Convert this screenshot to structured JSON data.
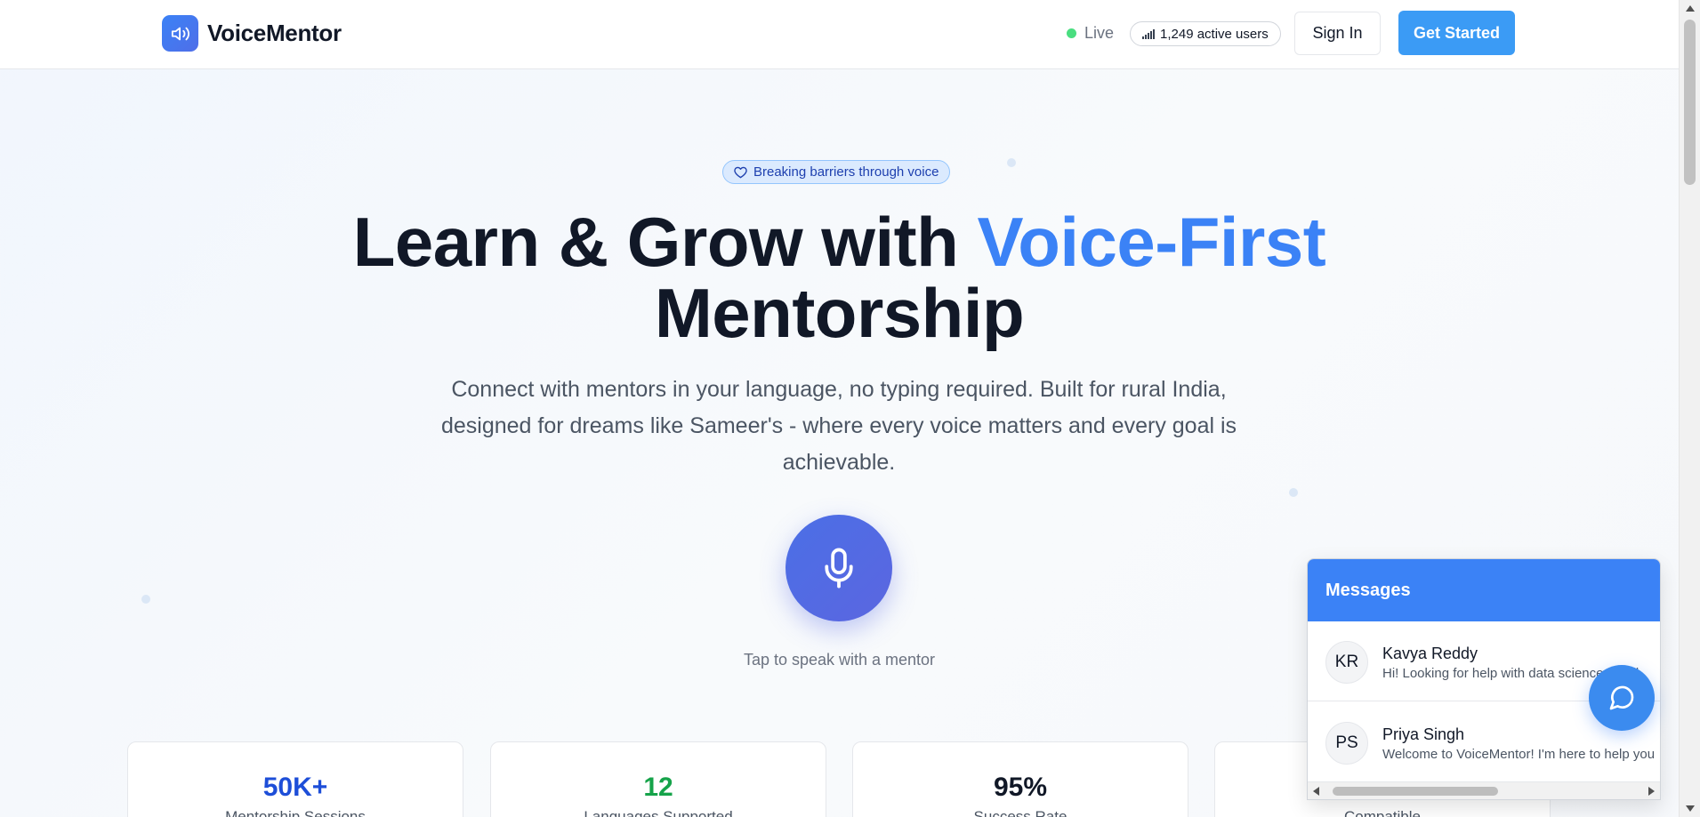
{
  "header": {
    "brand": "VoiceMentor",
    "live_label": "Live",
    "active_users": "1,249 active users",
    "sign_in": "Sign In",
    "get_started": "Get Started"
  },
  "hero": {
    "badge": "Breaking barriers through voice",
    "title_part1": "Learn & Grow with ",
    "title_accent": "Voice-First",
    "title_part2": "Mentorship",
    "subtitle": "Connect with mentors in your language, no typing required. Built for rural India, designed for dreams like Sameer's - where every voice matters and every goal is achievable.",
    "mic_label": "Tap to speak with a mentor"
  },
  "stats": [
    {
      "value": "50K+",
      "label": "Mentorship Sessions",
      "color": "#1d4ed8"
    },
    {
      "value": "12",
      "label": "Languages Supported",
      "color": "#16a34a"
    },
    {
      "value": "95%",
      "label": "Success Rate",
      "color": "#111827"
    },
    {
      "value": "",
      "label": "Compatible",
      "color": "#111827"
    }
  ],
  "messages": {
    "title": "Messages",
    "items": [
      {
        "initials": "KR",
        "name": "Kavya Reddy",
        "preview": "Hi! Looking for help with data science. Avail"
      },
      {
        "initials": "PS",
        "name": "Priya Singh",
        "preview": "Welcome to VoiceMentor! I'm here to help you"
      }
    ]
  },
  "colors": {
    "accent": "#3b82f6",
    "live_dot": "#4ade80",
    "mic": "#4f6ae6"
  },
  "icons": {
    "logo": "speaker-icon",
    "badge": "heart-icon",
    "users": "signal-bars-icon",
    "mic": "microphone-icon",
    "fab": "chat-bubble-icon"
  }
}
